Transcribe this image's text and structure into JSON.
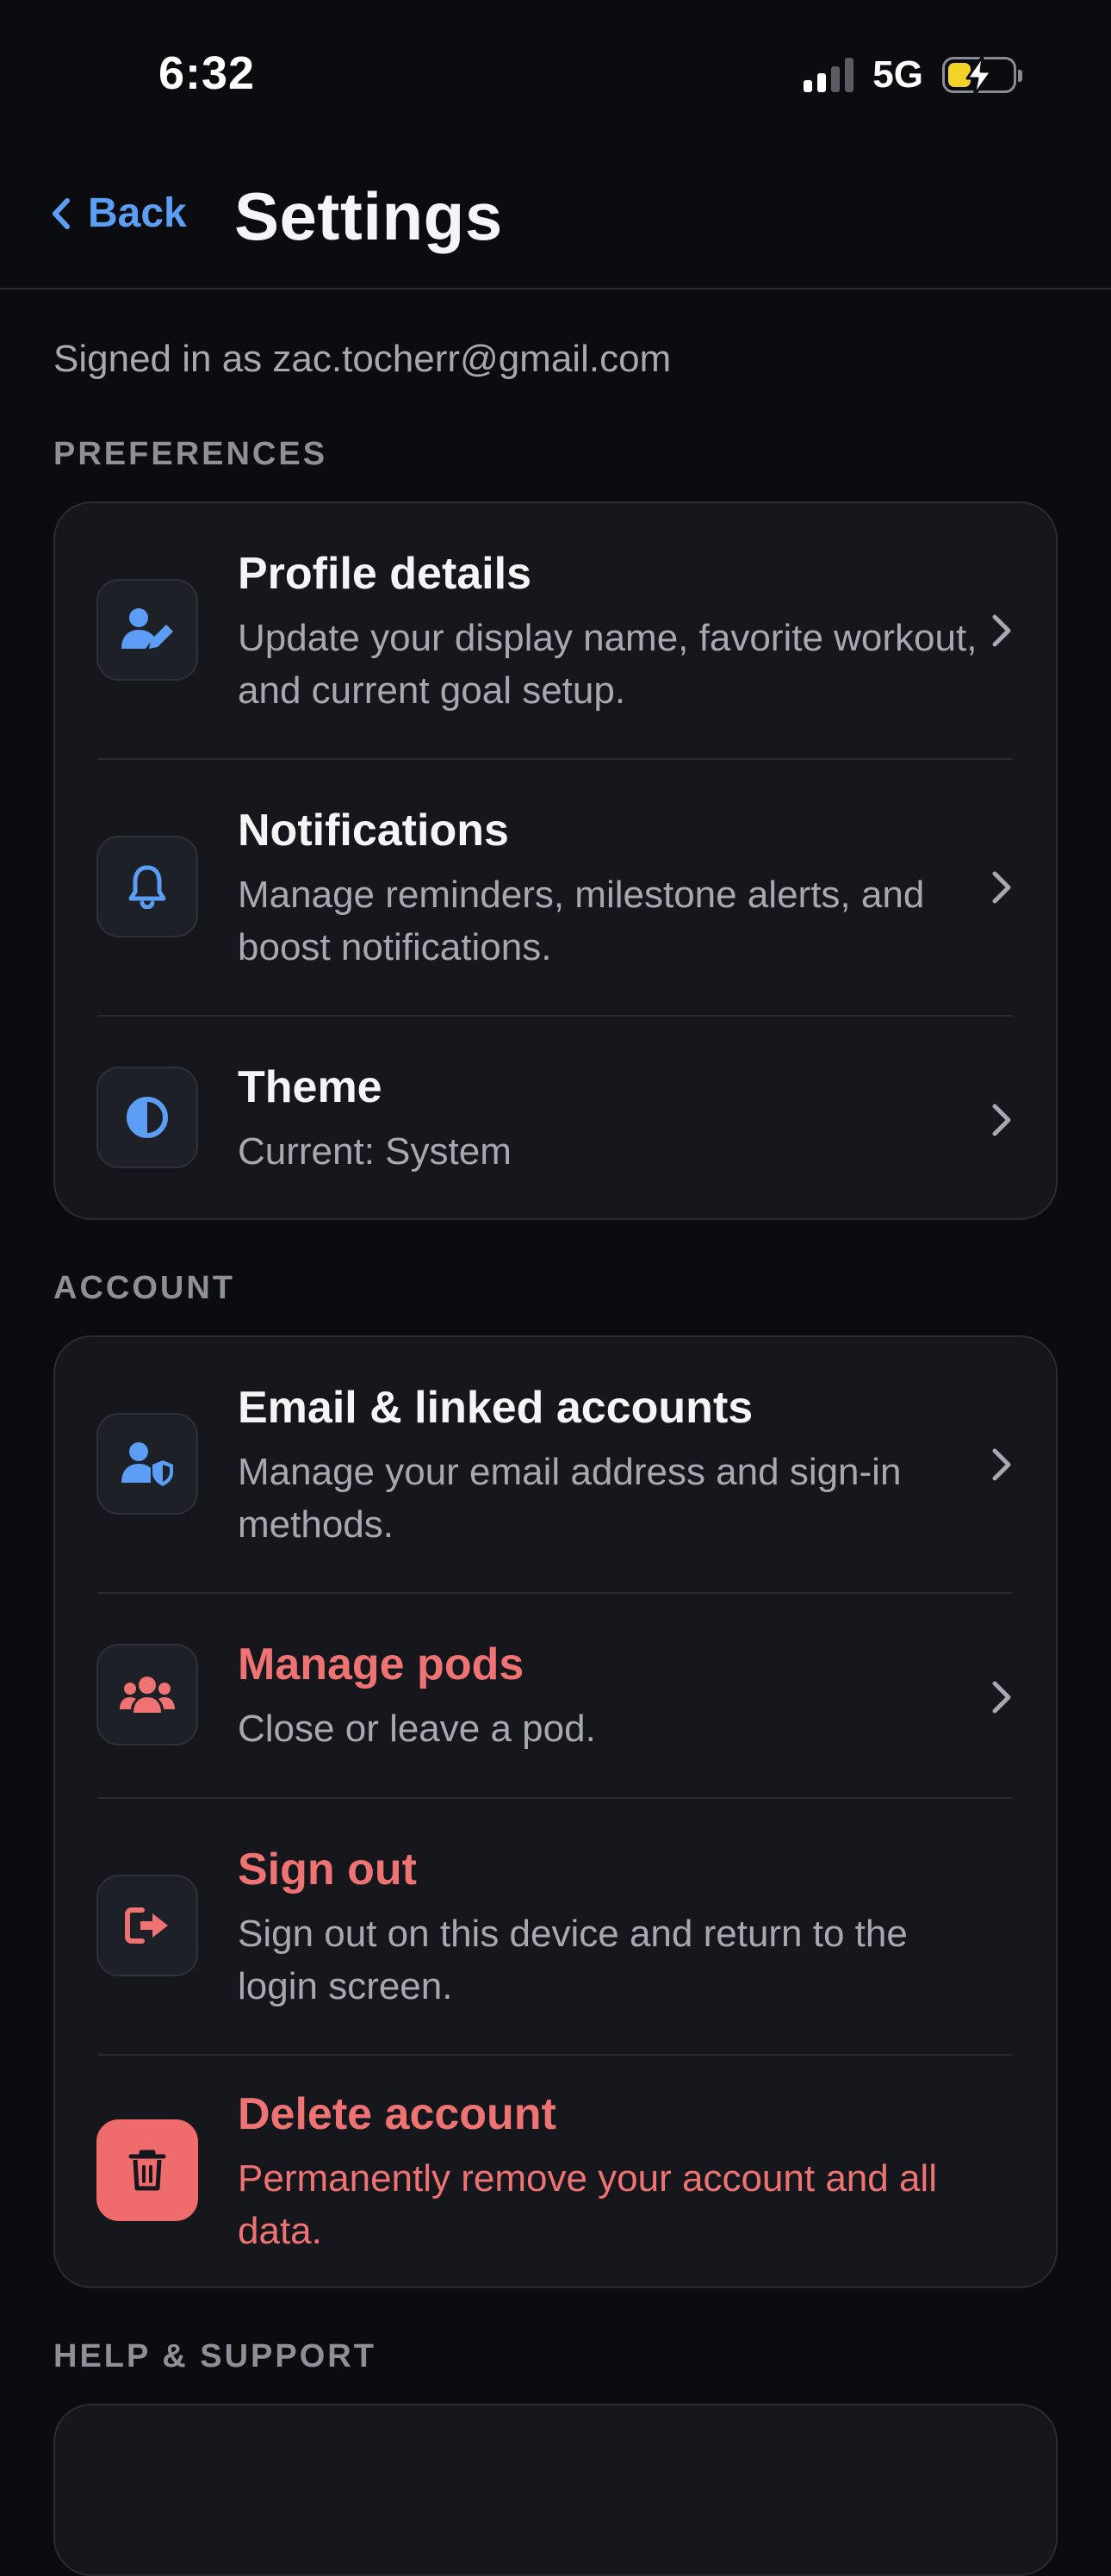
{
  "status_bar": {
    "time": "6:32",
    "network": "5G",
    "icons": [
      "cellular-signal-icon",
      "battery-charging-icon"
    ]
  },
  "header": {
    "back_label": "Back",
    "title": "Settings"
  },
  "signed_in_text": "Signed in as zac.tocherr@gmail.com",
  "sections": {
    "preferences": {
      "label": "PREFERENCES",
      "items": [
        {
          "title": "Profile details",
          "description": "Update your display name, favorite workout, and current goal setup.",
          "icon": "user-edit-icon"
        },
        {
          "title": "Notifications",
          "description": "Manage reminders, milestone alerts, and boost notifications.",
          "icon": "bell-icon"
        },
        {
          "title": "Theme",
          "description": "Current: System",
          "icon": "half-circle-contrast-icon"
        }
      ]
    },
    "account": {
      "label": "ACCOUNT",
      "items": [
        {
          "title": "Email & linked accounts",
          "description": "Manage your email address and sign-in methods.",
          "icon": "user-shield-icon"
        },
        {
          "title": "Manage pods",
          "description": "Close or leave a pod.",
          "icon": "users-group-icon"
        },
        {
          "title": "Sign out",
          "description": "Sign out on this device and return to the login screen.",
          "icon": "sign-out-icon"
        },
        {
          "title": "Delete account",
          "description": "Permanently remove your account and all data.",
          "icon": "trash-icon"
        }
      ]
    },
    "help": {
      "label": "HELP & SUPPORT"
    }
  },
  "colors": {
    "background": "#0b0c10",
    "card": "#15171c",
    "accent_blue": "#5c9df5",
    "danger_red": "#f07373",
    "battery_yellow": "#f3d22a"
  }
}
